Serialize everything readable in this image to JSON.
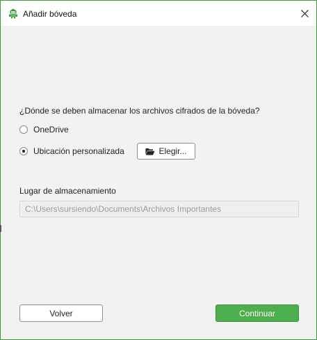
{
  "window": {
    "title": "Añadir bóveda",
    "close_icon": "close-icon",
    "app_icon": "cryptomator-robot-icon"
  },
  "location": {
    "question": "¿Dónde se deben almacenar los archivos cifrados de la bóveda?",
    "options": [
      {
        "label": "OneDrive",
        "selected": false
      },
      {
        "label": "Ubicación personalizada",
        "selected": true
      }
    ],
    "choose_button": {
      "label": "Elegir...",
      "icon": "folder-open-icon"
    }
  },
  "storage": {
    "label": "Lugar de almacenamiento",
    "path_value": "C:\\Users\\sursiendo\\Documents\\Archivos Importantes"
  },
  "footer": {
    "back_label": "Volver",
    "continue_label": "Continuar"
  },
  "colors": {
    "accent": "#4cae4c",
    "window_border": "#3a9a3a",
    "background": "#f2f2f2"
  }
}
